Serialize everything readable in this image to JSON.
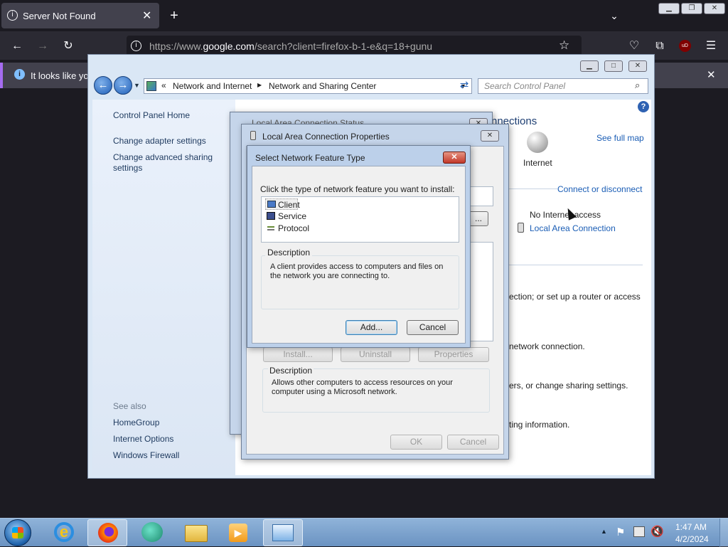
{
  "browser": {
    "tab_title": "Server Not Found",
    "url_host_prefix": "https://www.",
    "url_host": "google.com",
    "url_rest": "/search?client=firefox-b-1-e&q=18+gunu",
    "notice_text": "It looks like you"
  },
  "control_panel": {
    "breadcrumb_sep": "«",
    "breadcrumb_1": "Network and Internet",
    "breadcrumb_2": "Network and Sharing Center",
    "search_placeholder": "Search Control Panel",
    "left_home": "Control Panel Home",
    "left_adapter": "Change adapter settings",
    "left_advanced": "Change advanced sharing settings",
    "see_also": "See also",
    "homegroup": "HomeGroup",
    "internet_options": "Internet Options",
    "windows_firewall": "Windows Firewall",
    "connections_head": "nnections",
    "see_full_map": "See full map",
    "internet_label": "Internet",
    "connect_disconnect": "Connect or disconnect",
    "no_internet": "No Internet access",
    "local_area_link": "Local Area Connection",
    "text_router": "ection; or set up a router or access",
    "text_network": "network connection.",
    "text_sharing": "ers, or change sharing settings.",
    "text_info": "ting information."
  },
  "lac_status": {
    "title": "Local Area Connection Status"
  },
  "lac_props": {
    "title": "Local Area Connection Properties",
    "install": "Install...",
    "uninstall": "Uninstall",
    "properties": "Properties",
    "description_label": "Description",
    "description_text": "Allows other computers to access resources on your computer using a Microsoft network.",
    "ok": "OK",
    "cancel": "Cancel",
    "configure": "..."
  },
  "feature_dialog": {
    "title": "Select Network Feature Type",
    "prompt": "Click the type of network feature you want to install:",
    "items": [
      "Client",
      "Service",
      "Protocol"
    ],
    "description_label": "Description",
    "description_text": "A client provides access to computers and files on the network you are connecting to.",
    "add": "Add...",
    "cancel": "Cancel"
  },
  "taskbar": {
    "time": "1:47 AM",
    "date": "4/2/2024"
  }
}
